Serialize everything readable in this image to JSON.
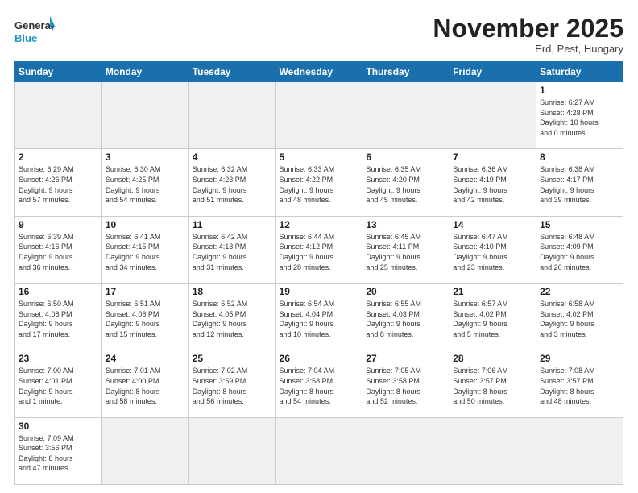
{
  "logo": {
    "text_general": "General",
    "text_blue": "Blue"
  },
  "title": "November 2025",
  "subtitle": "Erd, Pest, Hungary",
  "days_of_week": [
    "Sunday",
    "Monday",
    "Tuesday",
    "Wednesday",
    "Thursday",
    "Friday",
    "Saturday"
  ],
  "weeks": [
    [
      {
        "day": "",
        "info": "",
        "empty": true
      },
      {
        "day": "",
        "info": "",
        "empty": true
      },
      {
        "day": "",
        "info": "",
        "empty": true
      },
      {
        "day": "",
        "info": "",
        "empty": true
      },
      {
        "day": "",
        "info": "",
        "empty": true
      },
      {
        "day": "",
        "info": "",
        "empty": true
      },
      {
        "day": "1",
        "info": "Sunrise: 6:27 AM\nSunset: 4:28 PM\nDaylight: 10 hours\nand 0 minutes.",
        "empty": false
      }
    ],
    [
      {
        "day": "2",
        "info": "Sunrise: 6:29 AM\nSunset: 4:26 PM\nDaylight: 9 hours\nand 57 minutes.",
        "empty": false
      },
      {
        "day": "3",
        "info": "Sunrise: 6:30 AM\nSunset: 4:25 PM\nDaylight: 9 hours\nand 54 minutes.",
        "empty": false
      },
      {
        "day": "4",
        "info": "Sunrise: 6:32 AM\nSunset: 4:23 PM\nDaylight: 9 hours\nand 51 minutes.",
        "empty": false
      },
      {
        "day": "5",
        "info": "Sunrise: 6:33 AM\nSunset: 4:22 PM\nDaylight: 9 hours\nand 48 minutes.",
        "empty": false
      },
      {
        "day": "6",
        "info": "Sunrise: 6:35 AM\nSunset: 4:20 PM\nDaylight: 9 hours\nand 45 minutes.",
        "empty": false
      },
      {
        "day": "7",
        "info": "Sunrise: 6:36 AM\nSunset: 4:19 PM\nDaylight: 9 hours\nand 42 minutes.",
        "empty": false
      },
      {
        "day": "8",
        "info": "Sunrise: 6:38 AM\nSunset: 4:17 PM\nDaylight: 9 hours\nand 39 minutes.",
        "empty": false
      }
    ],
    [
      {
        "day": "9",
        "info": "Sunrise: 6:39 AM\nSunset: 4:16 PM\nDaylight: 9 hours\nand 36 minutes.",
        "empty": false
      },
      {
        "day": "10",
        "info": "Sunrise: 6:41 AM\nSunset: 4:15 PM\nDaylight: 9 hours\nand 34 minutes.",
        "empty": false
      },
      {
        "day": "11",
        "info": "Sunrise: 6:42 AM\nSunset: 4:13 PM\nDaylight: 9 hours\nand 31 minutes.",
        "empty": false
      },
      {
        "day": "12",
        "info": "Sunrise: 6:44 AM\nSunset: 4:12 PM\nDaylight: 9 hours\nand 28 minutes.",
        "empty": false
      },
      {
        "day": "13",
        "info": "Sunrise: 6:45 AM\nSunset: 4:11 PM\nDaylight: 9 hours\nand 25 minutes.",
        "empty": false
      },
      {
        "day": "14",
        "info": "Sunrise: 6:47 AM\nSunset: 4:10 PM\nDaylight: 9 hours\nand 23 minutes.",
        "empty": false
      },
      {
        "day": "15",
        "info": "Sunrise: 6:48 AM\nSunset: 4:09 PM\nDaylight: 9 hours\nand 20 minutes.",
        "empty": false
      }
    ],
    [
      {
        "day": "16",
        "info": "Sunrise: 6:50 AM\nSunset: 4:08 PM\nDaylight: 9 hours\nand 17 minutes.",
        "empty": false
      },
      {
        "day": "17",
        "info": "Sunrise: 6:51 AM\nSunset: 4:06 PM\nDaylight: 9 hours\nand 15 minutes.",
        "empty": false
      },
      {
        "day": "18",
        "info": "Sunrise: 6:52 AM\nSunset: 4:05 PM\nDaylight: 9 hours\nand 12 minutes.",
        "empty": false
      },
      {
        "day": "19",
        "info": "Sunrise: 6:54 AM\nSunset: 4:04 PM\nDaylight: 9 hours\nand 10 minutes.",
        "empty": false
      },
      {
        "day": "20",
        "info": "Sunrise: 6:55 AM\nSunset: 4:03 PM\nDaylight: 9 hours\nand 8 minutes.",
        "empty": false
      },
      {
        "day": "21",
        "info": "Sunrise: 6:57 AM\nSunset: 4:02 PM\nDaylight: 9 hours\nand 5 minutes.",
        "empty": false
      },
      {
        "day": "22",
        "info": "Sunrise: 6:58 AM\nSunset: 4:02 PM\nDaylight: 9 hours\nand 3 minutes.",
        "empty": false
      }
    ],
    [
      {
        "day": "23",
        "info": "Sunrise: 7:00 AM\nSunset: 4:01 PM\nDaylight: 9 hours\nand 1 minute.",
        "empty": false
      },
      {
        "day": "24",
        "info": "Sunrise: 7:01 AM\nSunset: 4:00 PM\nDaylight: 8 hours\nand 58 minutes.",
        "empty": false
      },
      {
        "day": "25",
        "info": "Sunrise: 7:02 AM\nSunset: 3:59 PM\nDaylight: 8 hours\nand 56 minutes.",
        "empty": false
      },
      {
        "day": "26",
        "info": "Sunrise: 7:04 AM\nSunset: 3:58 PM\nDaylight: 8 hours\nand 54 minutes.",
        "empty": false
      },
      {
        "day": "27",
        "info": "Sunrise: 7:05 AM\nSunset: 3:58 PM\nDaylight: 8 hours\nand 52 minutes.",
        "empty": false
      },
      {
        "day": "28",
        "info": "Sunrise: 7:06 AM\nSunset: 3:57 PM\nDaylight: 8 hours\nand 50 minutes.",
        "empty": false
      },
      {
        "day": "29",
        "info": "Sunrise: 7:08 AM\nSunset: 3:57 PM\nDaylight: 8 hours\nand 48 minutes.",
        "empty": false
      }
    ],
    [
      {
        "day": "30",
        "info": "Sunrise: 7:09 AM\nSunset: 3:56 PM\nDaylight: 8 hours\nand 47 minutes.",
        "empty": false
      },
      {
        "day": "",
        "info": "",
        "empty": true
      },
      {
        "day": "",
        "info": "",
        "empty": true
      },
      {
        "day": "",
        "info": "",
        "empty": true
      },
      {
        "day": "",
        "info": "",
        "empty": true
      },
      {
        "day": "",
        "info": "",
        "empty": true
      },
      {
        "day": "",
        "info": "",
        "empty": true
      }
    ]
  ]
}
